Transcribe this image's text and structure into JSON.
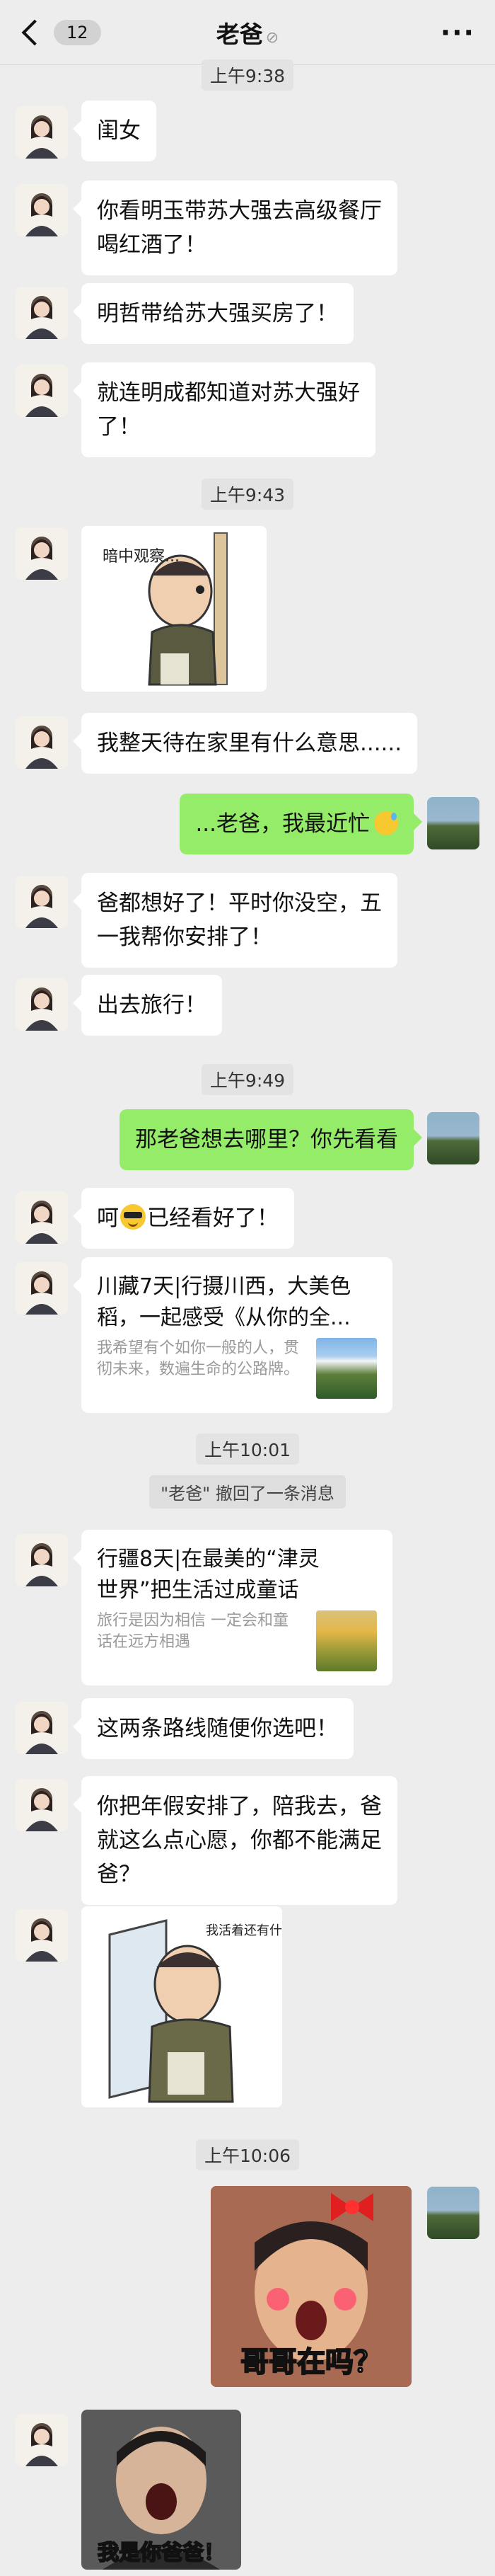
{
  "header": {
    "back_count": "12",
    "title": "老爸",
    "mute_glyph": "⊘"
  },
  "times": [
    "上午9:38",
    "上午9:43",
    "上午9:49",
    "上午10:01",
    "上午10:06"
  ],
  "recall_notice": "\"老爸\" 撤回了一条消息",
  "messages": {
    "m1": "闺女",
    "m2a": "你看明玉带苏大强去高级餐厅",
    "m2b": "喝红酒了！",
    "m3": "明哲带给苏大强买房了！",
    "m4a": "就连明成都知道对苏大强好",
    "m4b": "了！",
    "m5": "我整天待在家里有什么意思......",
    "m6": "...老爸，我最近忙",
    "m7a": "爸都想好了！平时你没空，五",
    "m7b": "一我帮你安排了！",
    "m8": "出去旅行！",
    "m9": "那老爸想去哪里？你先看看",
    "m10a": "呵",
    "m10b": "已经看好了！",
    "m11": "这两条路线随便你选吧！",
    "m12a": "你把年假安排了，陪我去，爸",
    "m12b": "就这么点心愿，你都不能满足",
    "m12c": "爸？"
  },
  "cards": [
    {
      "title_a": "川藏7天|行摄川西，大美色",
      "title_b": "稻，一起感受《从你的全...",
      "desc": "我希望有个如你一般的人，贯彻未来，数遍生命的公路牌。"
    },
    {
      "title_a": "行疆8天|在最美的“津灵",
      "title_b": "世界”把生活过成童话",
      "desc": "旅行是因为相信 一定会和童话在远方相遇"
    }
  ],
  "stickers": {
    "peek_caption": "暗中观察...",
    "tired_caption": "我活着还有什么脸面哪！",
    "brother_caption": "哥哥在吗？",
    "dad_caption": "我是你爸爸！"
  },
  "colors": {
    "background": "#ededed",
    "self_bubble": "#95ec69",
    "other_bubble": "#ffffff"
  }
}
